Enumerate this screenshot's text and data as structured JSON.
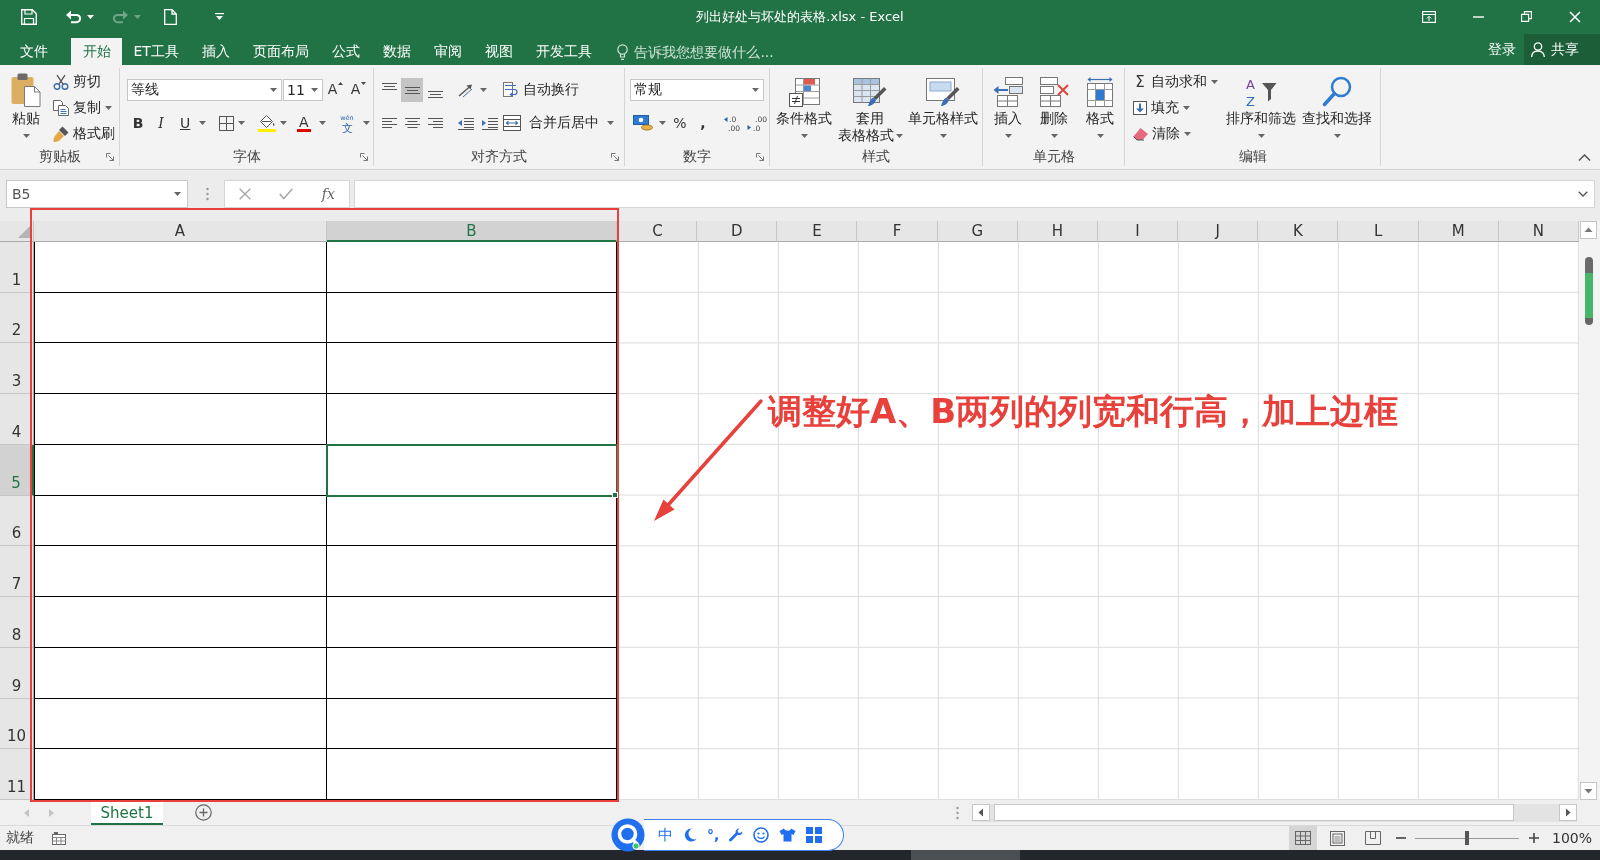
{
  "window": {
    "title": "列出好处与坏处的表格.xlsx - Excel",
    "quick_access": [
      {
        "kind": "save",
        "disabled": false
      },
      {
        "kind": "undo",
        "disabled": false
      },
      {
        "kind": "redo",
        "disabled": true
      },
      {
        "kind": "new",
        "disabled": false
      },
      {
        "kind": "customize",
        "disabled": false
      }
    ]
  },
  "tabs": [
    {
      "label": "文件",
      "selected": false
    },
    {
      "label": "开始",
      "selected": true
    },
    {
      "label": "ET工具",
      "selected": false
    },
    {
      "label": "插入",
      "selected": false
    },
    {
      "label": "页面布局",
      "selected": false
    },
    {
      "label": "公式",
      "selected": false
    },
    {
      "label": "数据",
      "selected": false
    },
    {
      "label": "审阅",
      "selected": false
    },
    {
      "label": "视图",
      "selected": false
    },
    {
      "label": "开发工具",
      "selected": false
    }
  ],
  "tell_me": {
    "placeholder": "告诉我您想要做什么..."
  },
  "account": {
    "sign_in": "登录",
    "share": "共享"
  },
  "ribbon": {
    "clipboard": {
      "label": "剪贴板",
      "paste": "粘贴",
      "cut": "剪切",
      "copy": "复制",
      "format_painter": "格式刷"
    },
    "font": {
      "label": "字体",
      "font_name": "等线",
      "font_size": "11",
      "grow": "A",
      "shrink": "A",
      "bold": "B",
      "italic": "I",
      "underline": "U",
      "font_color": "A",
      "phonetic": "wén",
      "phonetic_char": "文"
    },
    "alignment": {
      "label": "对齐方式",
      "vertical": [
        {
          "kind": "top",
          "selected": false
        },
        {
          "kind": "middle",
          "selected": true
        },
        {
          "kind": "bottom",
          "selected": false
        }
      ],
      "horizontal": [
        {
          "kind": "left",
          "selected": false
        },
        {
          "kind": "center",
          "selected": false
        },
        {
          "kind": "right",
          "selected": false
        }
      ],
      "wrap_text": "自动换行",
      "merge_center": "合并后居中"
    },
    "number": {
      "label": "数字",
      "format": "常规",
      "percent": "%",
      "comma": ",",
      "increase_decimal": [
        ".0",
        ".00"
      ],
      "decrease_decimal": [
        ".00",
        ".0"
      ]
    },
    "styles": {
      "label": "样式",
      "conditional_formatting": "条件格式",
      "format_as_table": [
        "套用",
        "表格格式"
      ],
      "cell_styles": "单元格样式"
    },
    "cells": {
      "label": "单元格",
      "insert": "插入",
      "delete": "删除",
      "format": "格式"
    },
    "editing": {
      "label": "编辑",
      "autosum_symbol": "Σ",
      "autosum": "自动求和",
      "fill": "填充",
      "clear": "清除",
      "sort_letters": [
        "A",
        "Z"
      ],
      "sort_filter": "排序和筛选",
      "find_select": "查找和选择"
    }
  },
  "formula_bar": {
    "name_box": "B5",
    "function_button": "fx"
  },
  "sheet": {
    "columns": [
      {
        "label": "A",
        "selected": false,
        "bordered": true
      },
      {
        "label": "B",
        "selected": true,
        "bordered": true
      },
      {
        "label": "C",
        "selected": false,
        "bordered": false
      },
      {
        "label": "D",
        "selected": false,
        "bordered": false
      },
      {
        "label": "E",
        "selected": false,
        "bordered": false
      },
      {
        "label": "F",
        "selected": false,
        "bordered": false
      },
      {
        "label": "G",
        "selected": false,
        "bordered": false
      },
      {
        "label": "H",
        "selected": false,
        "bordered": false
      },
      {
        "label": "I",
        "selected": false,
        "bordered": false
      },
      {
        "label": "J",
        "selected": false,
        "bordered": false
      },
      {
        "label": "K",
        "selected": false,
        "bordered": false
      },
      {
        "label": "L",
        "selected": false,
        "bordered": false
      },
      {
        "label": "M",
        "selected": false,
        "bordered": false
      },
      {
        "label": "N",
        "selected": false,
        "bordered": false
      }
    ],
    "rows": [
      {
        "label": "1",
        "selected": false
      },
      {
        "label": "2",
        "selected": false
      },
      {
        "label": "3",
        "selected": false
      },
      {
        "label": "4",
        "selected": false
      },
      {
        "label": "5",
        "selected": true
      },
      {
        "label": "6",
        "selected": false
      },
      {
        "label": "7",
        "selected": false
      },
      {
        "label": "8",
        "selected": false
      },
      {
        "label": "9",
        "selected": false
      },
      {
        "label": "10",
        "selected": false
      },
      {
        "label": "11",
        "selected": false
      }
    ]
  },
  "annotation": {
    "text": "调整好A、B两列的列宽和行高，加上边框"
  },
  "sheet_tabs": [
    {
      "label": "Sheet1",
      "selected": true
    }
  ],
  "status_bar": {
    "status": "就绪",
    "views": [
      {
        "kind": "normal",
        "selected": true
      },
      {
        "kind": "page_layout",
        "selected": false
      },
      {
        "kind": "page_break",
        "selected": false
      }
    ],
    "zoom": {
      "level": 0.5,
      "reading": "100%"
    }
  },
  "ime_toolbar": {
    "mode": "中",
    "punctuation": "°,"
  }
}
